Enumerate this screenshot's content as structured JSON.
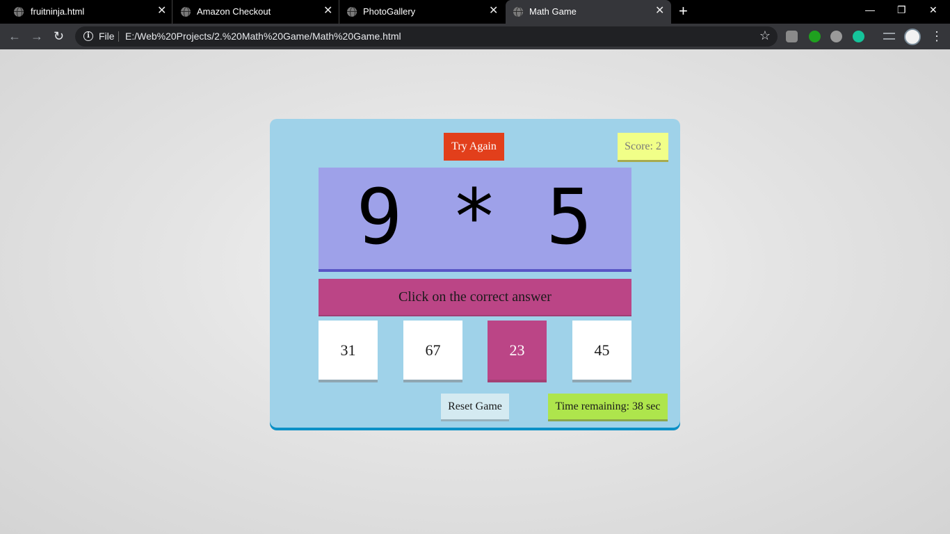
{
  "browser": {
    "tabs": [
      {
        "title": "fruitninja.html",
        "active": false
      },
      {
        "title": "Amazon Checkout",
        "active": false
      },
      {
        "title": "PhotoGallery",
        "active": false
      },
      {
        "title": "Math Game",
        "active": true
      }
    ],
    "new_tab_icon": "+",
    "close_icon": "✕",
    "window_controls": {
      "minimize": "—",
      "restore": "❐",
      "close": "✕"
    },
    "omnibox": {
      "scheme_label": "File",
      "url": "E:/Web%20Projects/2.%20Math%20Game/Math%20Game.html"
    },
    "icons": [
      "back-icon",
      "forward-icon",
      "reload-icon",
      "info-icon",
      "star-icon",
      "menu-icon"
    ]
  },
  "game": {
    "try_again_label": "Try Again",
    "score_text": "Score: 2",
    "question": "9 * 5",
    "instruction": "Click on the correct answer",
    "choices": [
      "31",
      "67",
      "23",
      "45"
    ],
    "highlighted_choice": 3,
    "reset_label": "Reset Game",
    "timer_text": "Time remaining: 38 sec"
  },
  "colors": {
    "container": "#9fd2e9",
    "try_again": "#e23f1b",
    "score": "#f1ff88",
    "question_box": "#9ea1e9",
    "instruction_box": "#bb4586",
    "timer": "#aee54c",
    "reset": "#d4eaf1"
  }
}
